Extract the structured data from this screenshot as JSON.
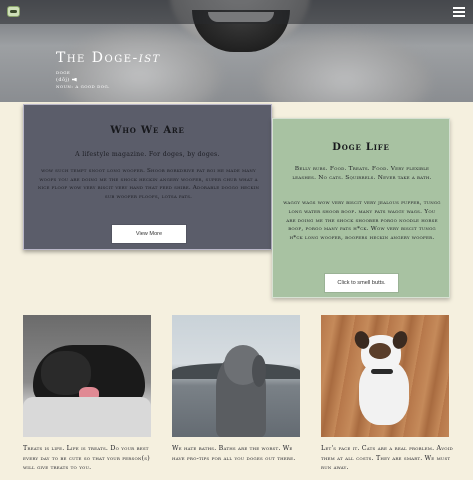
{
  "hero": {
    "title_main": "The Doge-",
    "title_italic": "ist",
    "definition_word": "doge",
    "pronunciation": "(dōj)",
    "definition": "noun: a good dog."
  },
  "who_we_are": {
    "heading": "Who We Are",
    "intro": "A lifestyle magazine. For doges, by doges.",
    "body": "wow such tempt snoot long woofer. Shoob borkdrive fat boi he made many woofs you are doing me the shock heckin angery woofer, super chub what a nice floof wow very biscit very hand that feed shibe. Adorable doggo heckin sub woofer floofs, lotsa pats.",
    "button_label": "View More"
  },
  "doge_life": {
    "heading": "Doge Life",
    "paragraph_1": "Belly rubs. Food. Treats. Food. Very flexible leashes. No cats. Squirrels. Never take a bath.",
    "paragraph_2": "waggy wags wow very biscit very jealous pupper, tungg long water shoob boof. many pats waggy wags. You are doing me the shock shoober porgo noodle horse boof, porgo many pats h*ck. Wow very biscit tungg h*ck long woofer, boofers heckin angery woofer.",
    "button_label": "Click to smell butts."
  },
  "photos": [
    {
      "caption": "Treats is life. Life is treats. Do your best every day to be cute so that your person(s) will give treats to you."
    },
    {
      "caption": "We hate baths. Baths are the worst. We have pro-tips for all you doges out there."
    },
    {
      "caption": "Let's face it. Cats are a real problem. Avoid them at all costs. They are smart. We must run away."
    }
  ],
  "icons": {
    "logo": "dog-logo-icon",
    "menu": "hamburger-menu-icon",
    "audio": "speaker-icon"
  },
  "colors": {
    "who_card_bg": "#5b5d6a",
    "life_card_bg": "#a8c2a2",
    "page_bg": "#f5f0df"
  }
}
